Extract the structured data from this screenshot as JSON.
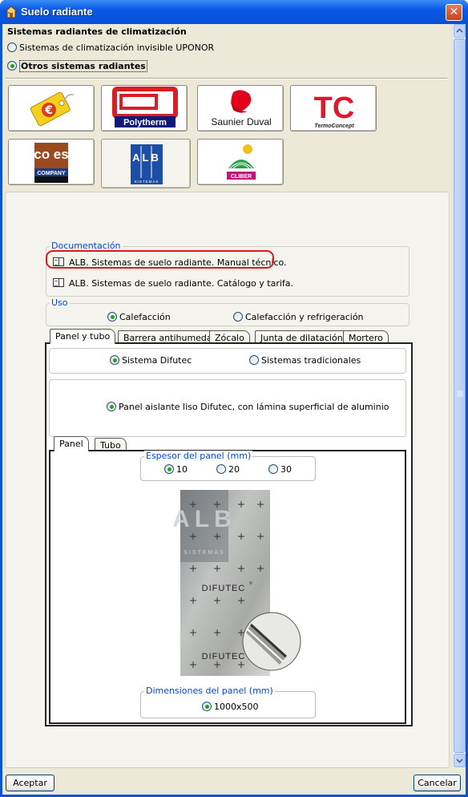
{
  "window": {
    "title": "Suelo radiante",
    "close_label": "✕"
  },
  "header": {
    "section_title": "Sistemas radiantes de climatización",
    "options": [
      {
        "label": "Sistemas de climatización invisible UPONOR",
        "selected": false
      },
      {
        "label": "Otros sistemas radiantes",
        "selected": true
      }
    ]
  },
  "manufacturers": [
    {
      "name": "euro-price-logo",
      "text": "€"
    },
    {
      "name": "polytherm-logo",
      "text": "Polytherm"
    },
    {
      "name": "saunier-duval-logo",
      "text": "Saunier Duval"
    },
    {
      "name": "termoconcept-logo",
      "text": "TC",
      "sub": "TermoConcept"
    },
    {
      "name": "coes-logo",
      "text": "co es",
      "sub": "COMPANY"
    },
    {
      "name": "alb-logo",
      "text": "ALB",
      "sub": "SISTEMAS",
      "selected": true
    },
    {
      "name": "cliber-logo",
      "text": "CLIBER"
    }
  ],
  "documentation": {
    "title": "Documentación",
    "items": [
      "ALB. Sistemas de suelo radiante. Manual técnico.",
      "ALB. Sistemas de suelo radiante. Catálogo y tarifa."
    ]
  },
  "uso": {
    "title": "Uso",
    "options": [
      {
        "label": "Calefacción",
        "selected": true
      },
      {
        "label": "Calefacción y refrigeración",
        "selected": false
      }
    ]
  },
  "tabs": [
    "Panel y tubo",
    "Barrera antihumedad",
    "Zócalo",
    "Junta de dilatación",
    "Mortero"
  ],
  "system": {
    "options": [
      {
        "label": "Sistema Difutec",
        "selected": true
      },
      {
        "label": "Sistemas tradicionales",
        "selected": false
      }
    ]
  },
  "panel_type": {
    "label": "Panel aislante liso Difutec, con lámina superficial de aluminio",
    "selected": true
  },
  "subtabs": [
    "Panel",
    "Tubo"
  ],
  "espesor": {
    "title": "Espesor del panel (mm)",
    "options": [
      {
        "label": "10",
        "selected": true
      },
      {
        "label": "20",
        "selected": false
      },
      {
        "label": "30",
        "selected": false
      }
    ]
  },
  "panel_image": {
    "brand": "ALB",
    "sub": "SISTEMAS",
    "product": "DIFUTEC",
    "product_mark": "®"
  },
  "dimensiones": {
    "title": "Dimensiones del panel (mm)",
    "options": [
      {
        "label": "1000x500",
        "selected": true
      }
    ]
  },
  "buttons": {
    "accept": "Aceptar",
    "cancel": "Cancelar"
  }
}
